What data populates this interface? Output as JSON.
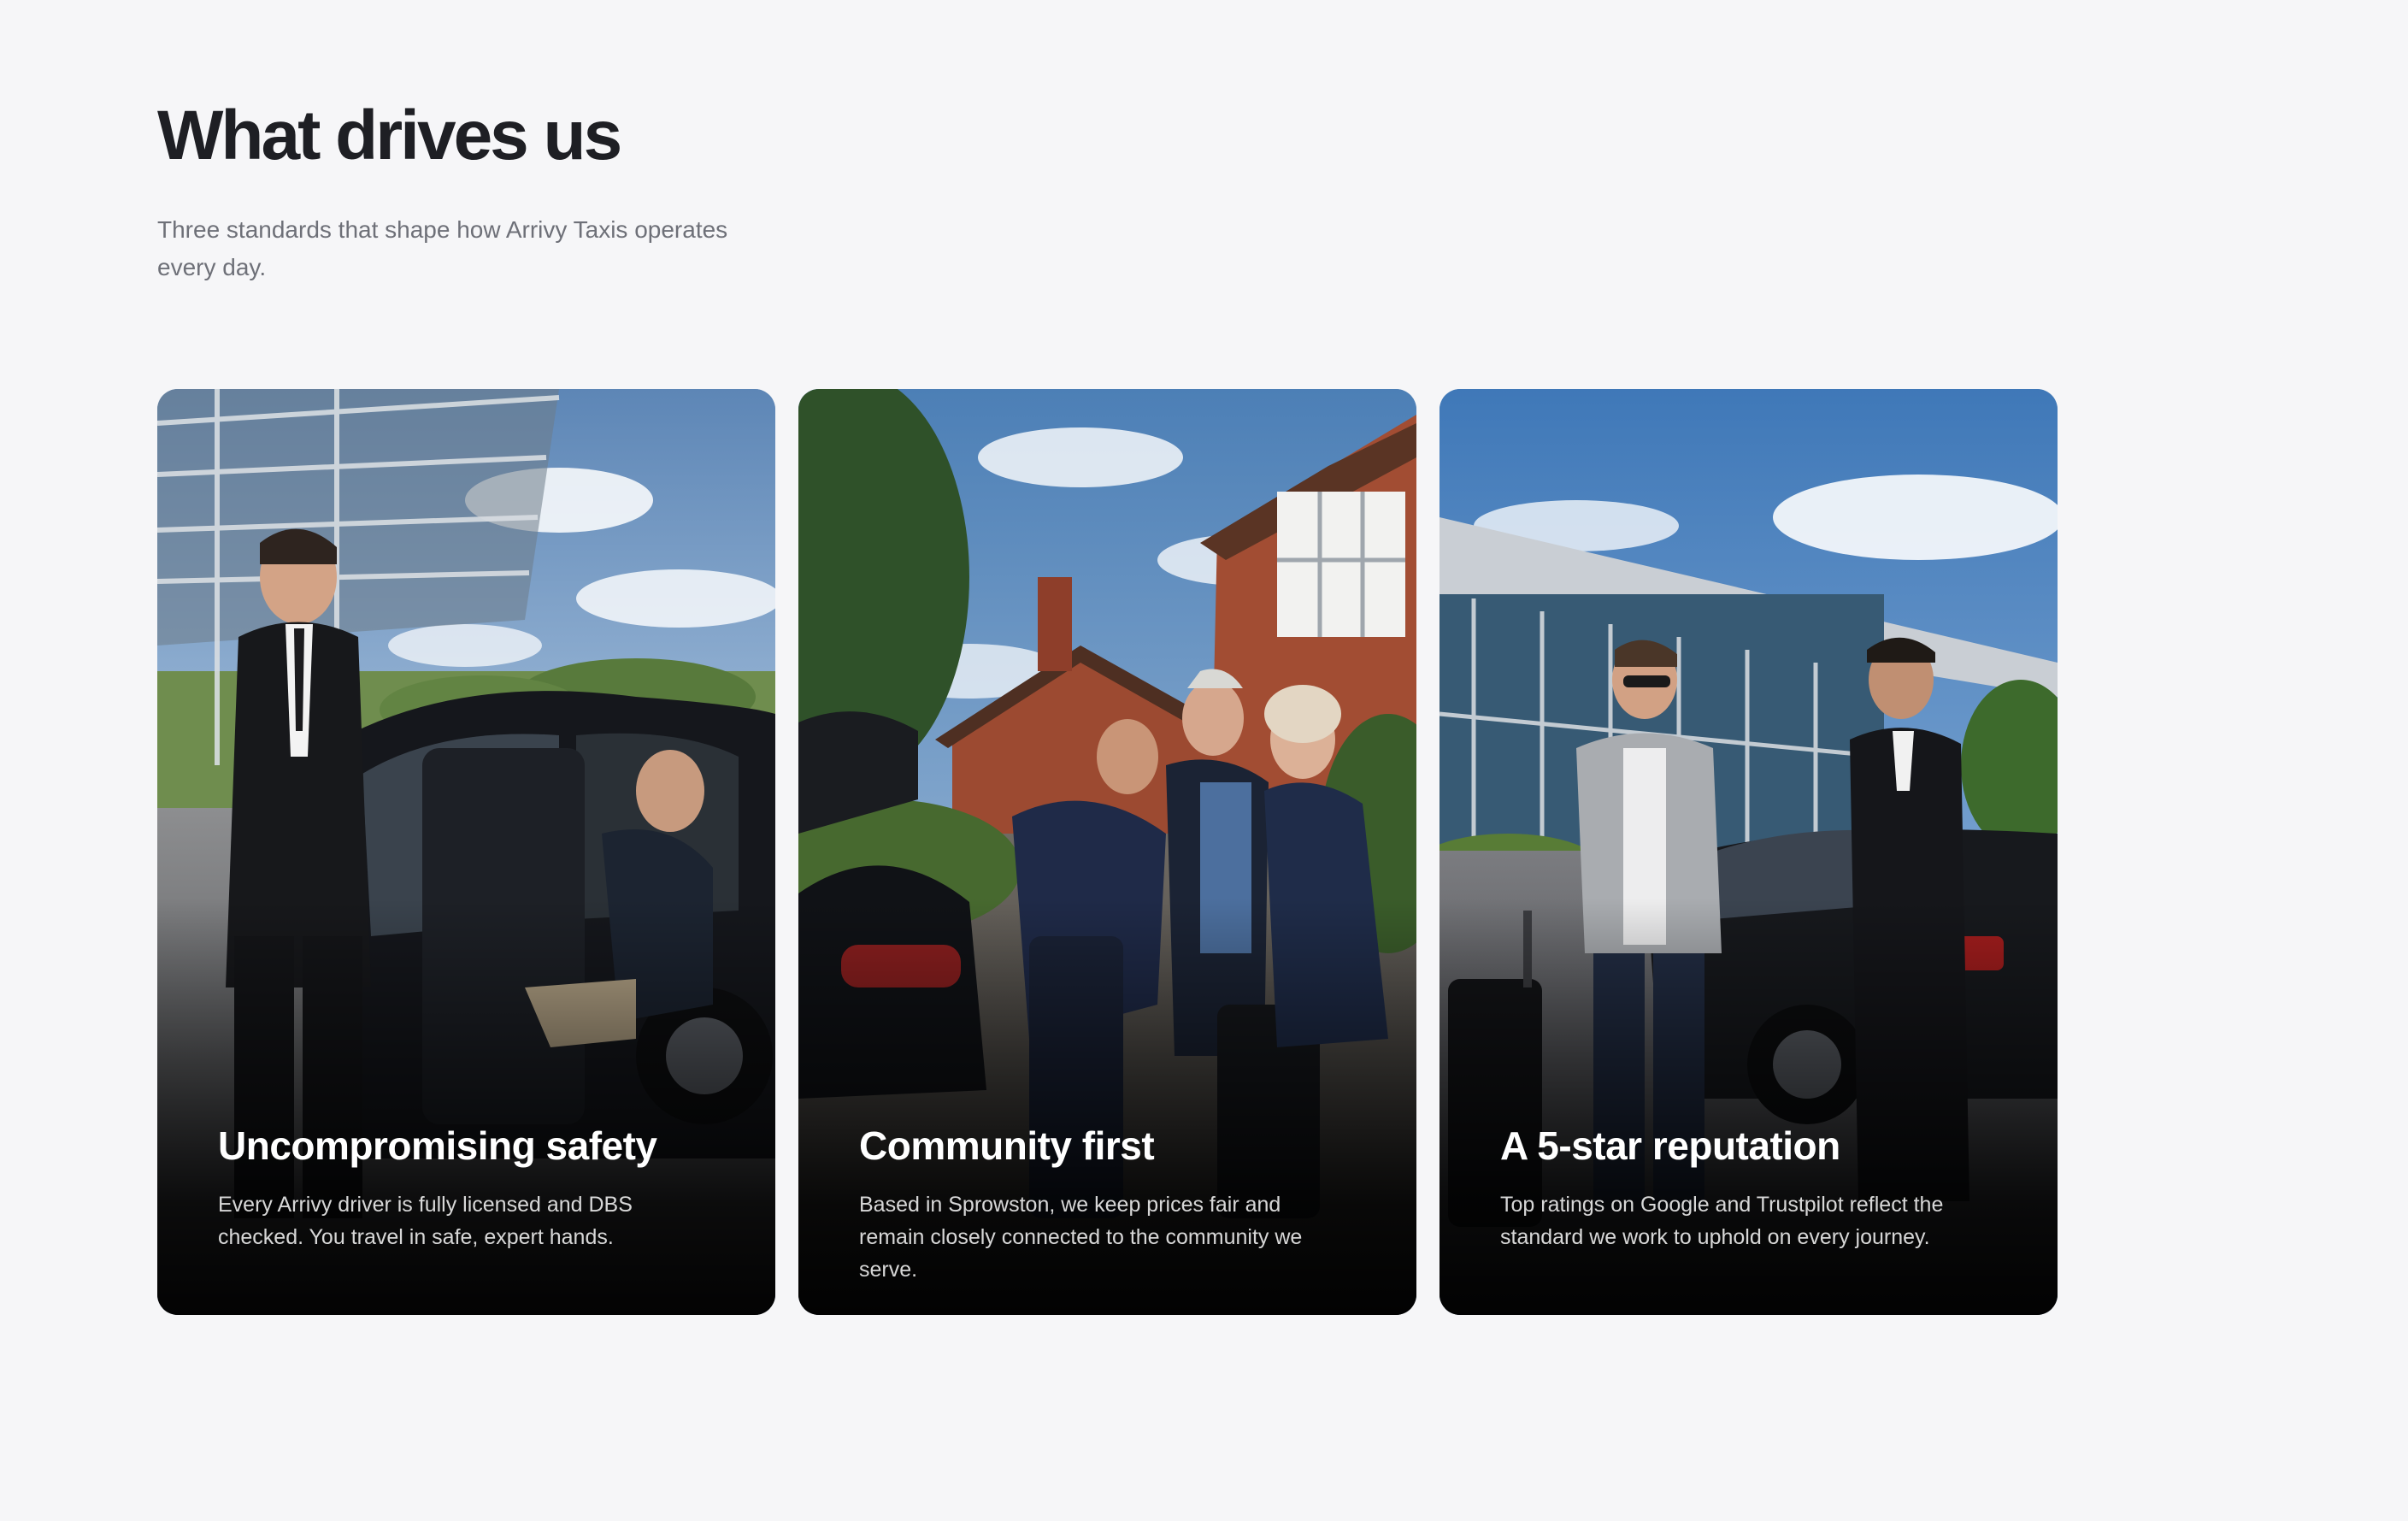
{
  "header": {
    "title": "What drives us",
    "subtitle": "Three standards that shape how Arrivy Taxis operates every day."
  },
  "cards": [
    {
      "title": "Uncompromising safety",
      "text": "Every Arrivy driver is fully licensed and DBS checked. You travel in safe, expert hands.",
      "image": "chauffeur-opening-car-door-photo"
    },
    {
      "title": "Community first",
      "text": "Based in Sprowston, we keep prices fair and remain closely connected to the community we serve.",
      "image": "driver-helping-couple-with-luggage-photo"
    },
    {
      "title": "A 5-star reputation",
      "text": "Top ratings on Google and Trustpilot reflect the standard we work to uphold on every journey.",
      "image": "driver-greeting-traveller-at-airport-photo"
    }
  ],
  "colors": {
    "background": "#f6f6f8",
    "heading": "#1e1f24",
    "subtitle": "#6e7078",
    "card_text": "#ffffff"
  }
}
